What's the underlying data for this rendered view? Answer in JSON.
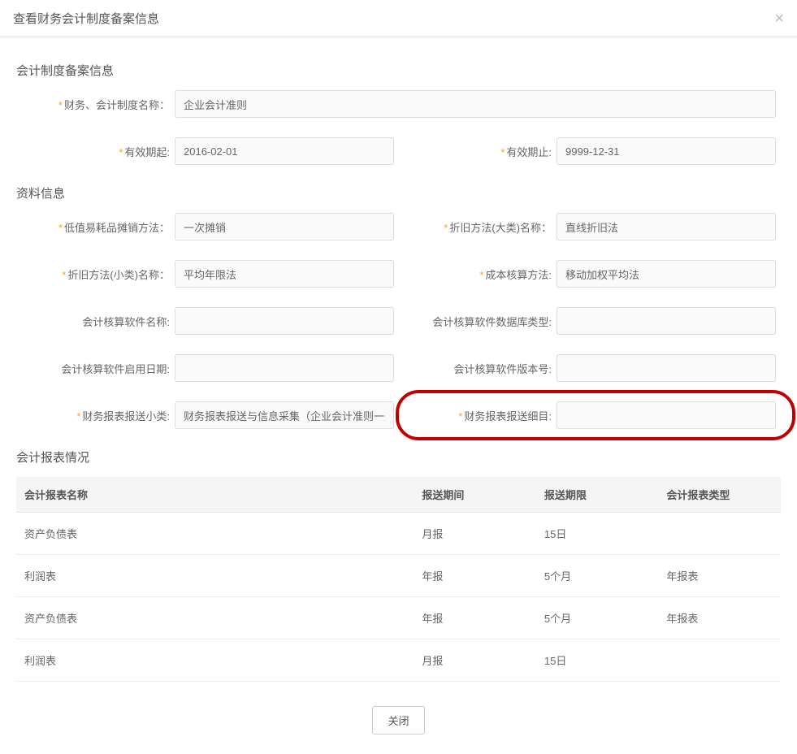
{
  "dialog": {
    "title": "查看财务会计制度备案信息",
    "close_icon": "×"
  },
  "sections": {
    "filing_info": "会计制度备案信息",
    "material_info": "资料信息",
    "report_info": "会计报表情况"
  },
  "fields": {
    "system_name": {
      "label": "财务、会计制度名称：",
      "value": "企业会计准则"
    },
    "valid_from": {
      "label": "有效期起:",
      "value": "2016-02-01"
    },
    "valid_to": {
      "label": "有效期止:",
      "value": "9999-12-31"
    },
    "low_value": {
      "label": "低值易耗品摊销方法：",
      "value": "一次摊销"
    },
    "depr_major": {
      "label": "折旧方法(大类)名称：",
      "value": "直线折旧法"
    },
    "depr_minor": {
      "label": "折旧方法(小类)名称：",
      "value": "平均年限法"
    },
    "cost_method": {
      "label": "成本核算方法:",
      "value": "移动加权平均法"
    },
    "sw_name": {
      "label": "会计核算软件名称:",
      "value": ""
    },
    "sw_db": {
      "label": "会计核算软件数据库类型:",
      "value": ""
    },
    "sw_date": {
      "label": "会计核算软件启用日期:",
      "value": ""
    },
    "sw_ver": {
      "label": "会计核算软件版本号:",
      "value": ""
    },
    "rpt_minor": {
      "label": "财务报表报送小类:",
      "value": "财务报表报送与信息采集（企业会计准则一般企业"
    },
    "rpt_detail": {
      "label": "财务报表报送细目:",
      "value": ""
    }
  },
  "table": {
    "headers": [
      "会计报表名称",
      "报送期间",
      "报送期限",
      "会计报表类型"
    ],
    "rows": [
      {
        "name": "资产负债表",
        "period": "月报",
        "deadline": "15日",
        "type": ""
      },
      {
        "name": "利润表",
        "period": "年报",
        "deadline": "5个月",
        "type": "年报表"
      },
      {
        "name": "资产负债表",
        "period": "年报",
        "deadline": "5个月",
        "type": "年报表"
      },
      {
        "name": "利润表",
        "period": "月报",
        "deadline": "15日",
        "type": ""
      }
    ]
  },
  "footer": {
    "close_label": "关闭"
  }
}
